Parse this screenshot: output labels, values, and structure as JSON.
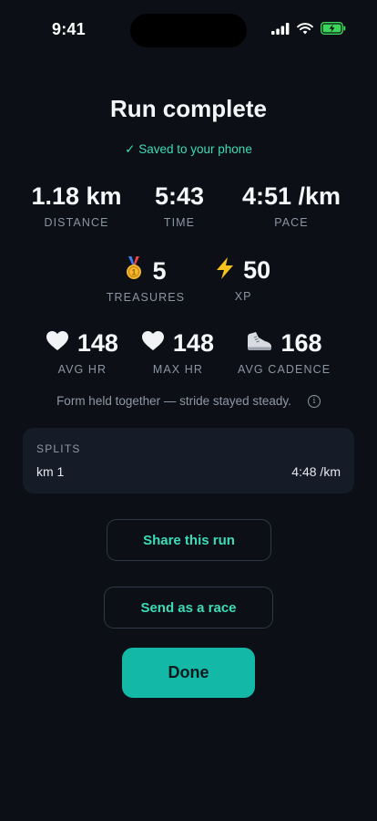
{
  "status_bar": {
    "time": "9:41"
  },
  "header": {
    "title": "Run complete",
    "saved_status": "✓ Saved to your phone"
  },
  "primary_stats": [
    {
      "value": "1.18 km",
      "label": "DISTANCE"
    },
    {
      "value": "5:43",
      "label": "TIME"
    },
    {
      "value": "4:51 /km",
      "label": "PACE"
    }
  ],
  "rewards": [
    {
      "icon": "medal-icon",
      "value": "5",
      "label": "TREASURES"
    },
    {
      "icon": "lightning-icon",
      "value": "50",
      "label": "XP"
    }
  ],
  "body_stats": [
    {
      "icon": "heart-icon",
      "value": "148",
      "label": "AVG HR"
    },
    {
      "icon": "heart-icon",
      "value": "148",
      "label": "MAX HR"
    },
    {
      "icon": "shoe-icon",
      "value": "168",
      "label": "AVG CADENCE"
    }
  ],
  "form_note": "Form held together — stride stayed steady.",
  "splits": {
    "title": "SPLITS",
    "rows": [
      {
        "km": "km 1",
        "pace": "4:48 /km"
      }
    ]
  },
  "actions": {
    "share_label": "Share this run",
    "race_label": "Send as a race",
    "done_label": "Done"
  },
  "colors": {
    "accent": "#3ddbb7",
    "done_button": "#14b8a6",
    "background": "#0c1016",
    "card": "#161c27"
  }
}
